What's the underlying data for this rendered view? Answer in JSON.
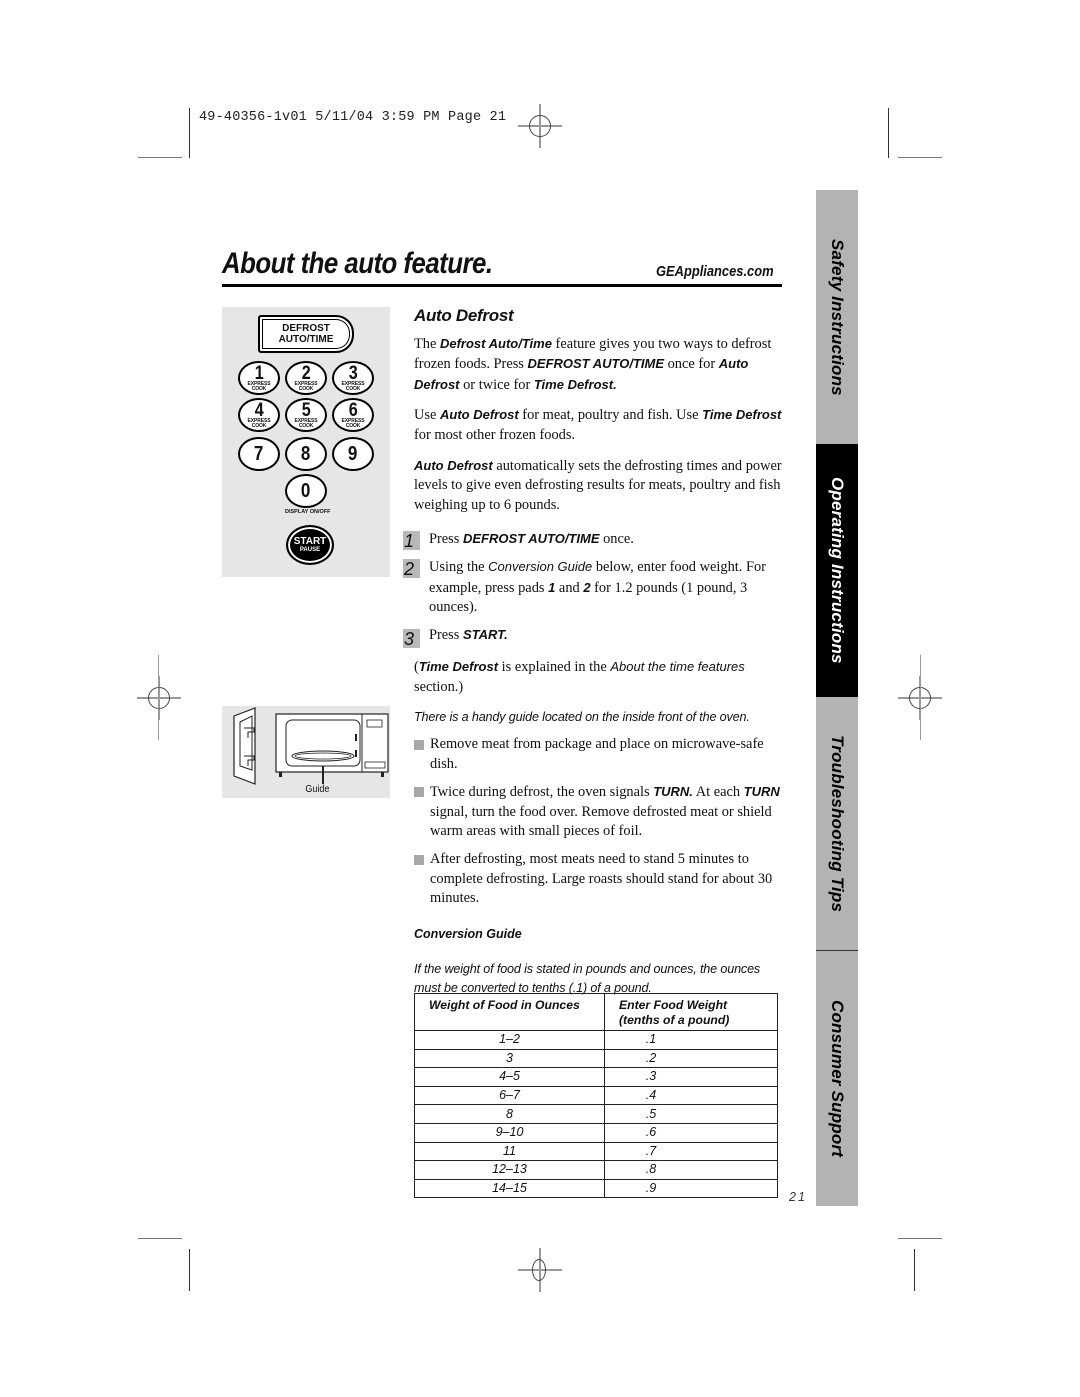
{
  "print_slug": "49-40356-1v01 5/11/04 3:59 PM Page 21",
  "header": {
    "title": "About the auto feature.",
    "website": "GEAppliances.com"
  },
  "side_tabs": [
    {
      "label": "Safety Instructions",
      "active": false
    },
    {
      "label": "Operating Instructions",
      "active": true
    },
    {
      "label": "Troubleshooting Tips",
      "active": false
    },
    {
      "label": "Consumer Support",
      "active": false
    }
  ],
  "keypad": {
    "defrost_key": {
      "line1": "DEFROST",
      "line2": "AUTO/TIME"
    },
    "keys": [
      {
        "num": "1",
        "sub1": "EXPRESS",
        "sub2": "COOK"
      },
      {
        "num": "2",
        "sub1": "EXPRESS",
        "sub2": "COOK"
      },
      {
        "num": "3",
        "sub1": "EXPRESS",
        "sub2": "COOK"
      },
      {
        "num": "4",
        "sub1": "EXPRESS",
        "sub2": "COOK"
      },
      {
        "num": "5",
        "sub1": "EXPRESS",
        "sub2": "COOK"
      },
      {
        "num": "6",
        "sub1": "EXPRESS",
        "sub2": "COOK"
      },
      {
        "num": "7"
      },
      {
        "num": "8"
      },
      {
        "num": "9"
      },
      {
        "num": "0"
      }
    ],
    "zero_caption": "DISPLAY ON/OFF",
    "start_key": {
      "line1": "START",
      "line2": "PAUSE"
    }
  },
  "oven_illustration": {
    "guide_label": "Guide"
  },
  "section": {
    "heading": "Auto Defrost",
    "p1": {
      "t1": "The ",
      "b1": "Defrost Auto/Time",
      "t2": "  feature gives you two ways to defrost frozen foods. Press ",
      "b2": "DEFROST AUTO/TIME",
      "t3": "  once for ",
      "b3": "Auto Defrost",
      "t4": " or twice for ",
      "b4": "Time Defrost."
    },
    "p2": {
      "t1": "Use ",
      "b1": "Auto Defrost",
      "t2": "  for meat, poultry and fish. Use ",
      "b2": "Time Defrost",
      "t3": "  for most other frozen foods."
    },
    "p3": {
      "b1": "Auto Defrost",
      "t1": "  automatically sets the defrosting times and power levels to give even defrosting results for meats, poultry and fish weighing up to 6 pounds."
    },
    "steps": [
      {
        "num": "1",
        "t1": "Press ",
        "b1": "DEFROST AUTO/TIME",
        "t2": "  once."
      },
      {
        "num": "2",
        "t1": "Using the ",
        "i1": "Conversion Guide",
        "t2": " below, enter food weight. For example, press pads ",
        "b1": "1",
        "t3": " and ",
        "b2": "2",
        "t4": "  for 1.2 pounds (1 pound, 3 ounces)."
      },
      {
        "num": "3",
        "t1": "Press ",
        "b1": "START."
      }
    ],
    "p4": {
      "t1": "(",
      "b1": "Time Defrost",
      "t2": "  is explained in the ",
      "i1": "About the time features",
      "t3": " section.)"
    },
    "handy_note": "There is a handy guide located on the inside front of the oven.",
    "bullets": [
      {
        "t1": "Remove meat from package and place on microwave-safe dish."
      },
      {
        "t1": "Twice during defrost, the oven signals ",
        "b1": "TURN.",
        "t2": " At each ",
        "b2": "TURN",
        "t3": " signal, turn the food over. Remove defrosted meat or shield warm areas with small pieces of foil."
      },
      {
        "t1": "After defrosting, most meats need to stand 5 minutes to complete defrosting. Large roasts should stand for about 30 minutes."
      }
    ]
  },
  "conversion_guide": {
    "heading": "Conversion Guide",
    "intro": "If the weight of food is stated in pounds and ounces, the ounces must be converted to tenths (.1) of a pound.",
    "columns": [
      "Weight of Food in Ounces",
      "Enter Food Weight (tenths of a pound)"
    ],
    "rows": [
      [
        "1–2",
        ".1"
      ],
      [
        "3",
        ".2"
      ],
      [
        "4–5",
        ".3"
      ],
      [
        "6–7",
        ".4"
      ],
      [
        "8",
        ".5"
      ],
      [
        "9–10",
        ".6"
      ],
      [
        "11",
        ".7"
      ],
      [
        "12–13",
        ".8"
      ],
      [
        "14–15",
        ".9"
      ]
    ]
  },
  "page_number": "21"
}
